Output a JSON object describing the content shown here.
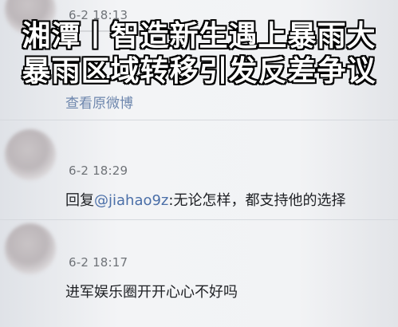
{
  "headline": {
    "line1": "湘潭丨智造新生遇上暴雨大",
    "line2": "暴雨区域转移引发反差争议"
  },
  "top_comment": {
    "time": "6-2 18:13",
    "view_original_label": "查看原微博"
  },
  "comments": [
    {
      "time": "6-2 18:29",
      "reply_prefix": "回复",
      "mention": "@jiahao9z",
      "body": ":无论怎样，都支持他的选择"
    },
    {
      "time": "6-2 18:17",
      "body": "进军娱乐圈开开心心不好吗"
    }
  ],
  "colors": {
    "link": "#6d86ad",
    "mention": "#4b6fa8",
    "meta": "#6f7378",
    "text": "#1e2024",
    "headline_fill": "#ffffff",
    "headline_outline": "#000000"
  }
}
